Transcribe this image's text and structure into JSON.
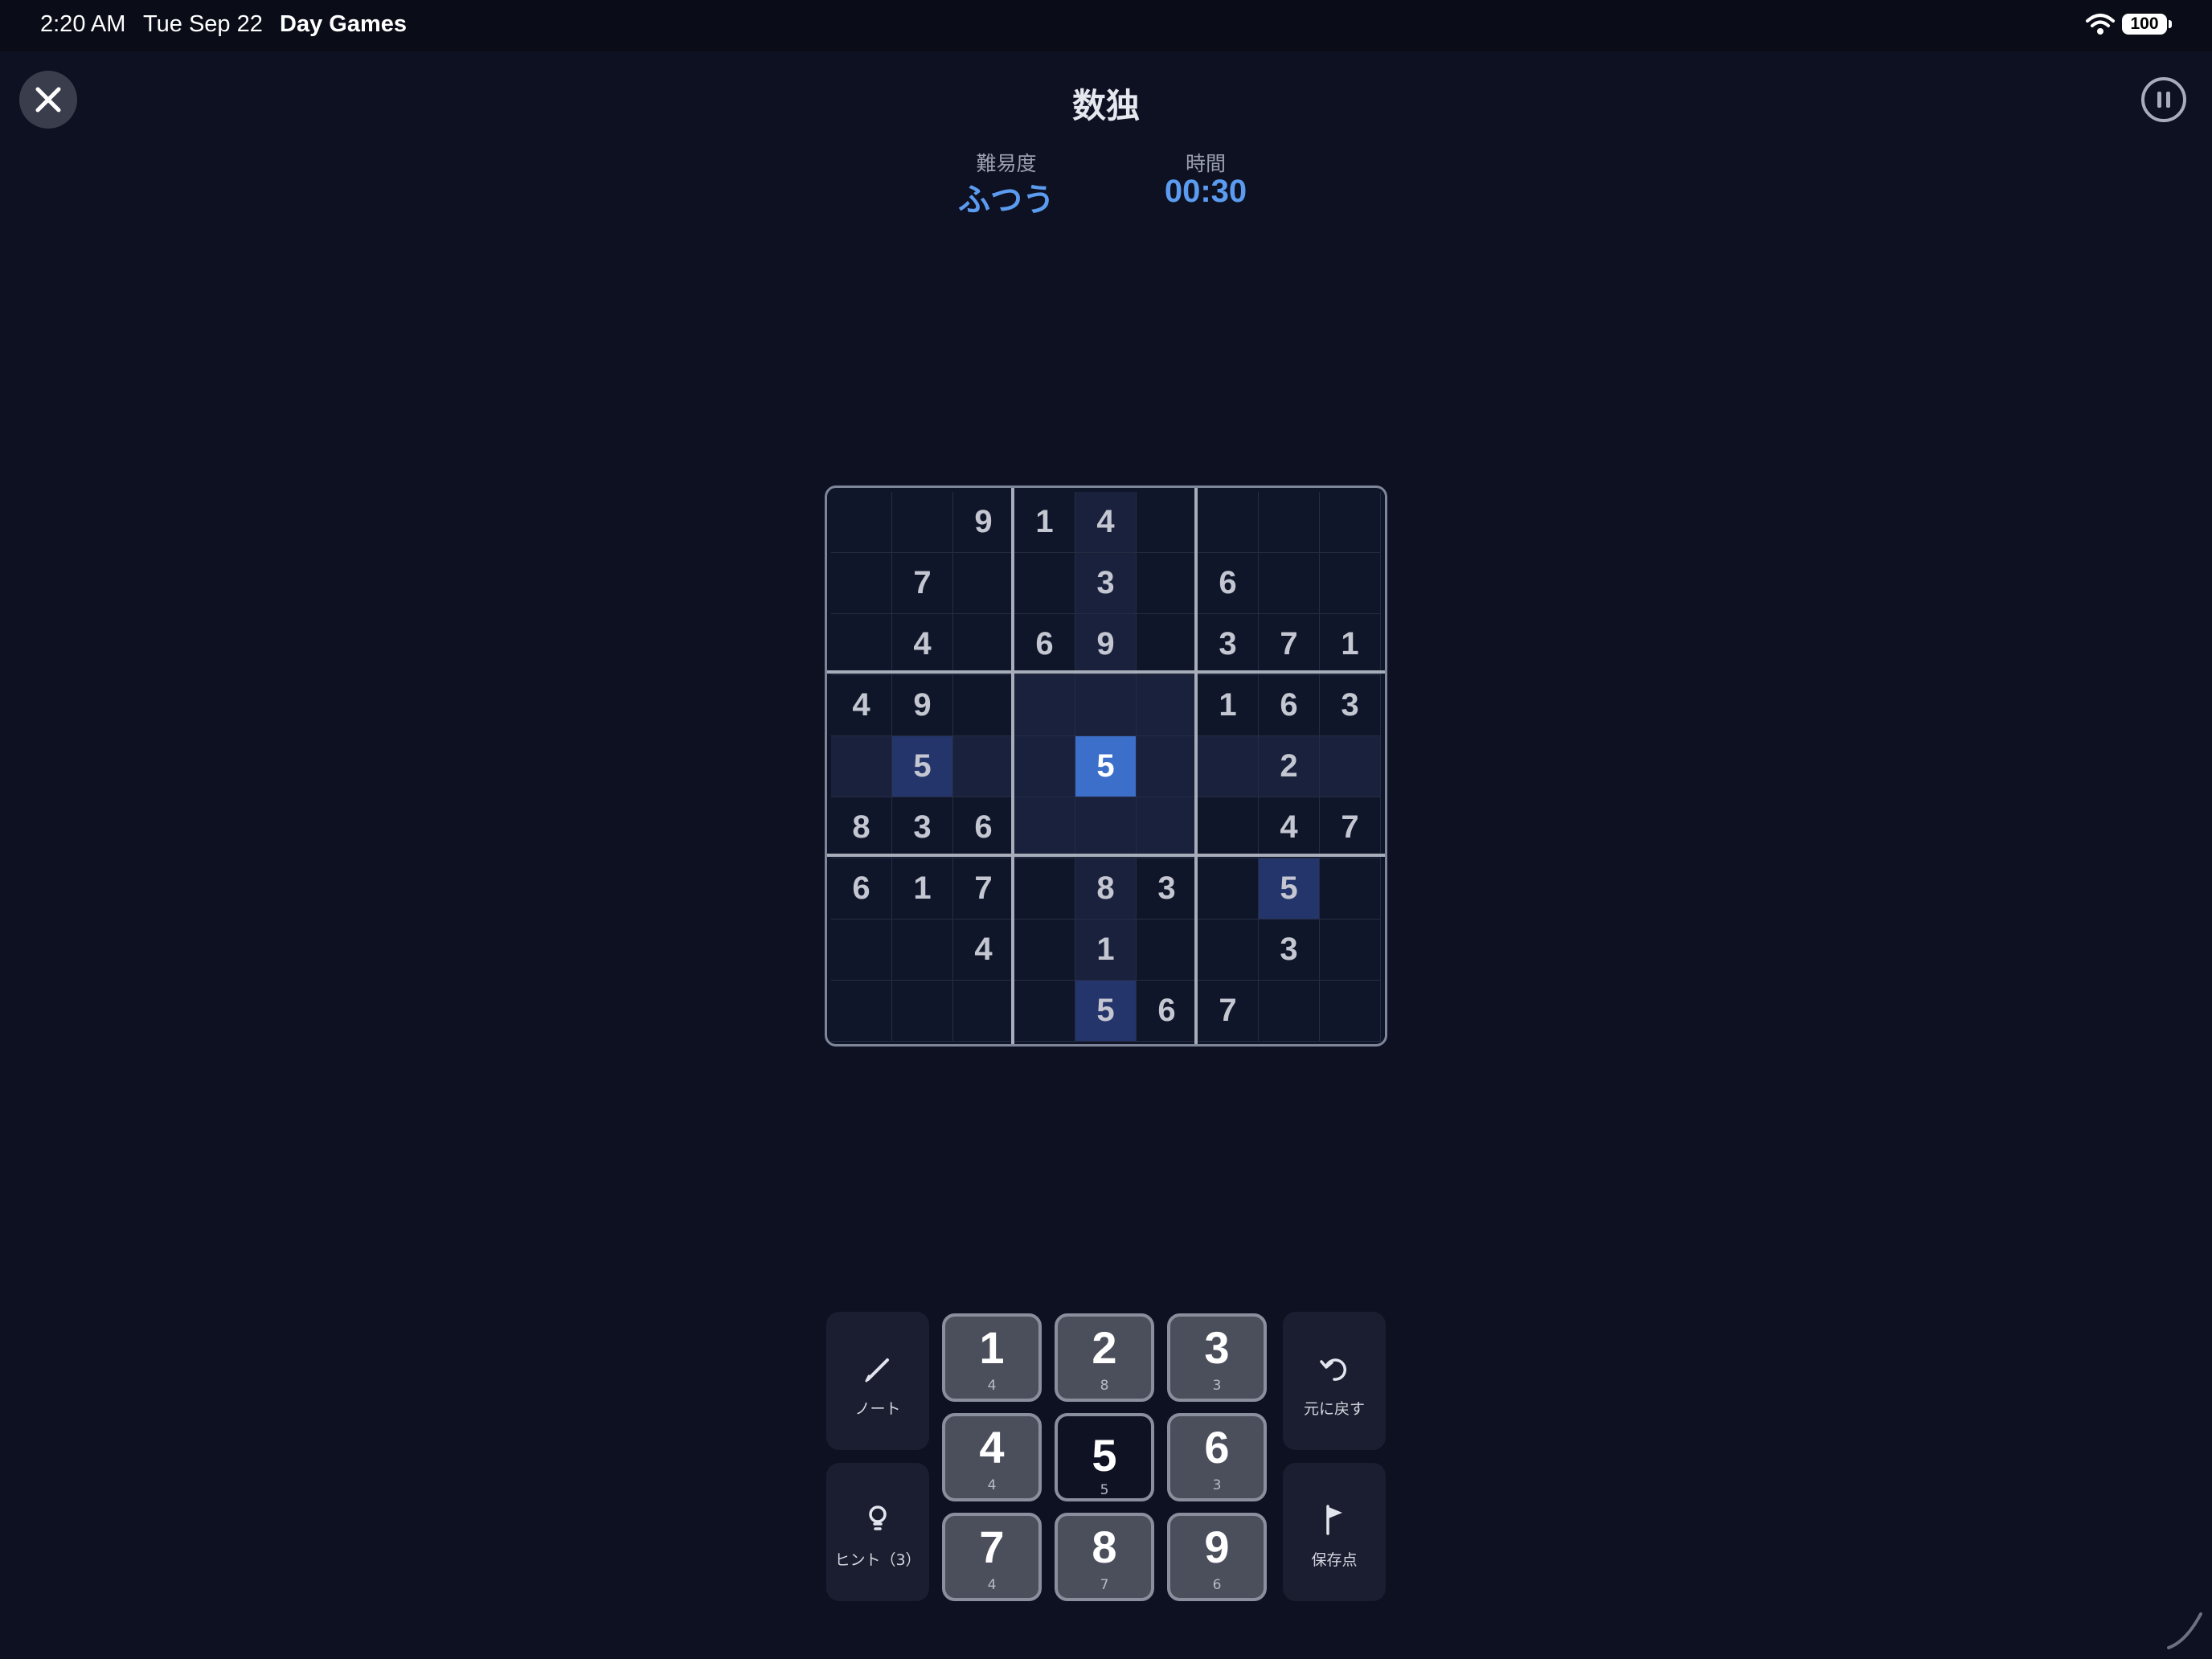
{
  "status_bar": {
    "time": "2:20 AM",
    "date": "Tue Sep 22",
    "app": "Day Games",
    "battery": "100"
  },
  "header": {
    "title": "数独",
    "close_icon": "close-icon",
    "pause_icon": "pause-icon"
  },
  "info": {
    "difficulty_label": "難易度",
    "difficulty_value": "ふつう",
    "time_label": "時間",
    "time_value": "00:30"
  },
  "board": {
    "selected": [
      4,
      4
    ],
    "rows": [
      [
        "",
        "",
        "9",
        "1",
        "4",
        "",
        "",
        "",
        ""
      ],
      [
        "",
        "7",
        "",
        "",
        "3",
        "",
        "6",
        "",
        ""
      ],
      [
        "",
        "4",
        "",
        "6",
        "9",
        "",
        "3",
        "7",
        "1"
      ],
      [
        "4",
        "9",
        "",
        "",
        "",
        "",
        "1",
        "6",
        "3"
      ],
      [
        "",
        "5",
        "",
        "",
        "5",
        "",
        "",
        "2",
        ""
      ],
      [
        "8",
        "3",
        "6",
        "",
        "",
        "",
        "",
        "4",
        "7"
      ],
      [
        "6",
        "1",
        "7",
        "",
        "8",
        "3",
        "",
        "5",
        ""
      ],
      [
        "",
        "",
        "4",
        "",
        "1",
        "",
        "",
        "3",
        ""
      ],
      [
        "",
        "",
        "",
        "",
        "5",
        "6",
        "7",
        "",
        ""
      ]
    ]
  },
  "controls": {
    "note_label": "ノート",
    "hint_label": "ヒント（3）",
    "undo_label": "元に戻す",
    "save_label": "保存点",
    "numbers": [
      {
        "n": "1",
        "count": "4"
      },
      {
        "n": "2",
        "count": "8"
      },
      {
        "n": "3",
        "count": "3"
      },
      {
        "n": "4",
        "count": "4"
      },
      {
        "n": "5",
        "count": "5"
      },
      {
        "n": "6",
        "count": "3"
      },
      {
        "n": "7",
        "count": "4"
      },
      {
        "n": "8",
        "count": "7"
      },
      {
        "n": "9",
        "count": "6"
      }
    ],
    "active_number": "5"
  },
  "colors": {
    "background": "#0e1122",
    "accent": "#5b9cf0",
    "selected_cell": "#3b6fca"
  }
}
